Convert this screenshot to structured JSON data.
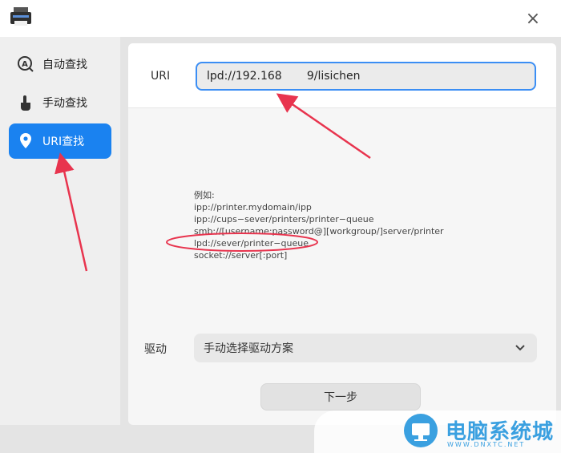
{
  "sidebar": {
    "items": [
      {
        "label": "自动查找",
        "icon": "auto-find-icon"
      },
      {
        "label": "手动查找",
        "icon": "hand-pointer-icon"
      },
      {
        "label": "URI查找",
        "icon": "location-pin-icon"
      }
    ],
    "active_index": 2
  },
  "uri": {
    "label": "URI",
    "value": "lpd://192.168       9/lisichen"
  },
  "examples": {
    "heading": "例如:",
    "lines": [
      "ipp://printer.mydomain/ipp",
      "ipp://cups−sever/printers/printer−queue",
      "smb://[username:password@][workgroup/]server/printer",
      "lpd://sever/printer−queue",
      "socket://server[:port]"
    ]
  },
  "driver": {
    "label": "驱动",
    "selected": "手动选择驱动方案"
  },
  "next_button": "下一步",
  "watermark": {
    "text": "电脑系统城",
    "sub": "WWW.DNXTC.NET"
  },
  "colors": {
    "accent": "#1a82f0",
    "annotation": "#e8344e"
  }
}
